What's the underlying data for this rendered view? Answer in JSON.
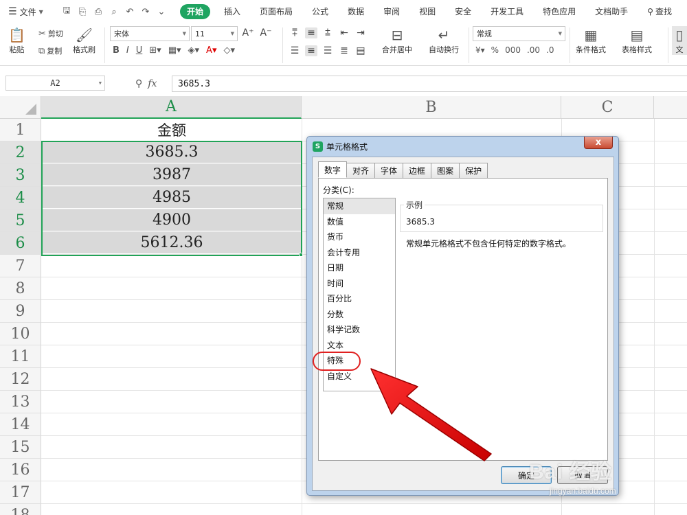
{
  "menubar": {
    "file": "文件",
    "tabs": [
      "开始",
      "插入",
      "页面布局",
      "公式",
      "数据",
      "审阅",
      "视图",
      "安全",
      "开发工具",
      "特色应用",
      "文档助手"
    ],
    "search": "查找"
  },
  "ribbon": {
    "paste": "粘贴",
    "cut": "剪切",
    "copy": "复制",
    "format_painter": "格式刷",
    "font_name": "宋体",
    "font_size": "11",
    "merge_center": "合并居中",
    "wrap_text": "自动换行",
    "number_format": "常规",
    "conditional_format": "条件格式",
    "table_style": "表格样式",
    "doc": "文"
  },
  "formula_bar": {
    "name_box": "A2",
    "fx": "fx",
    "value": "3685.3"
  },
  "grid": {
    "columns": [
      "A",
      "B",
      "C"
    ],
    "rows": [
      "1",
      "2",
      "3",
      "4",
      "5",
      "6",
      "7",
      "8",
      "9",
      "10",
      "11",
      "12",
      "13",
      "14",
      "15",
      "16",
      "17",
      "18"
    ],
    "cells": [
      "金额",
      "3685.3",
      "3987",
      "4985",
      "4900",
      "5612.36"
    ]
  },
  "dialog": {
    "title": "单元格格式",
    "close": "x",
    "tabs": [
      "数字",
      "对齐",
      "字体",
      "边框",
      "图案",
      "保护"
    ],
    "category_label": "分类(C):",
    "categories": [
      "常规",
      "数值",
      "货币",
      "会计专用",
      "日期",
      "时间",
      "百分比",
      "分数",
      "科学记数",
      "文本",
      "特殊",
      "自定义"
    ],
    "sample_label": "示例",
    "sample_value": "3685.3",
    "description": "常规单元格格式不包含任何特定的数字格式。",
    "ok": "确定",
    "cancel": "取消"
  },
  "watermark": {
    "brand": "Bai 经验",
    "url": "jingyan.baidu.com"
  },
  "colors": {
    "accent_green": "#1fa461",
    "selection_green": "#21a357",
    "annotation_red": "#e02020"
  }
}
